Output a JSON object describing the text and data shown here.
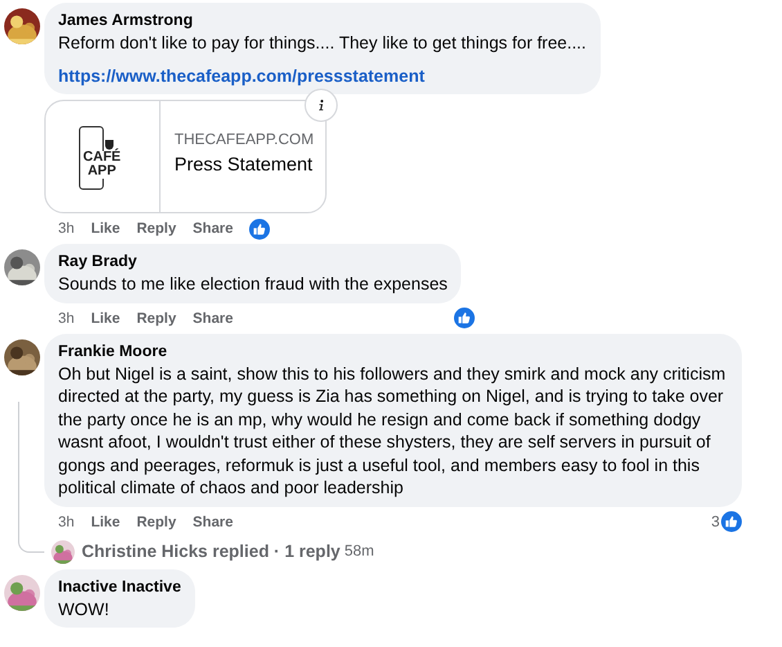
{
  "comments": [
    {
      "author": "James Armstrong",
      "text": "Reform don't like to pay for things.... They like to get things for free....",
      "link": "https://www.thecafeapp.com/pressstatement",
      "preview": {
        "logo_lines": [
          "CAFÉ",
          "APP"
        ],
        "domain": "THECAFEAPP.COM",
        "title": "Press Statement"
      },
      "time": "3h",
      "actions": [
        "Like",
        "Reply",
        "Share"
      ],
      "reacted": true
    },
    {
      "author": "Ray Brady",
      "text": "Sounds to me like election fraud with the expenses",
      "time": "3h",
      "actions": [
        "Like",
        "Reply",
        "Share"
      ],
      "reacted": true
    },
    {
      "author": "Frankie Moore",
      "text": "Oh but Nigel is a saint, show this to his followers and they smirk and mock any criticism directed at the party, my guess is Zia has something on Nigel, and is trying to take over the party once he is an mp, why would he resign and come back if something dodgy wasnt afoot, I wouldn't trust either of these shysters, they are self servers in pursuit of gongs and peerages, reformuk is just a useful tool, and members easy to fool in this political climate of chaos and poor leadership",
      "time": "3h",
      "actions": [
        "Like",
        "Reply",
        "Share"
      ],
      "reacted": true,
      "reaction_count": "3",
      "replies": {
        "summary": "Christine Hicks replied · 1 reply",
        "time": "58m"
      }
    },
    {
      "author": "Inactive Inactive",
      "text": "WOW!"
    }
  ]
}
